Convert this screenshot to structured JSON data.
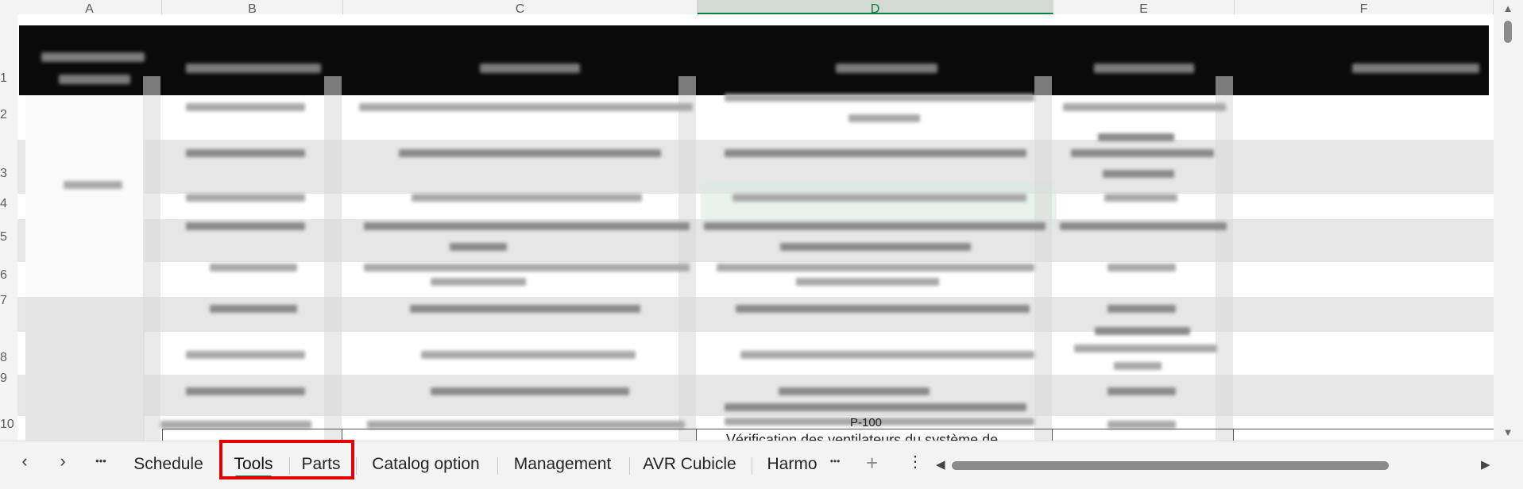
{
  "columns": [
    "A",
    "B",
    "C",
    "D",
    "E",
    "F"
  ],
  "selected_column": "D",
  "row_numbers": [
    "1",
    "2",
    "3",
    "4",
    "5",
    "6",
    "7",
    "8",
    "9",
    "10"
  ],
  "visible_cell_text": {
    "d10_top": "P-100",
    "d10_text": "Vérification des ventilateurs du système de"
  },
  "sheet_tabs": [
    "Schedule",
    "Tools",
    "Parts",
    "Catalog option",
    "Management",
    "AVR Cubicle",
    "Harmo"
  ],
  "active_tab": "Tools",
  "icons": {
    "prev": "chevron-left-icon",
    "next": "chevron-right-icon",
    "more": "more-horizontal-icon",
    "add": "plus-icon",
    "options": "more-vertical-icon"
  },
  "glyphs": {
    "prev": "‹",
    "next": "›",
    "more": "•••",
    "add": "+",
    "options": "⋮",
    "scroll_left": "◀",
    "scroll_right": "▶",
    "scroll_up": "▲",
    "scroll_down": "▼"
  },
  "accent_color": "#107c41",
  "highlight_color": "#e30000"
}
